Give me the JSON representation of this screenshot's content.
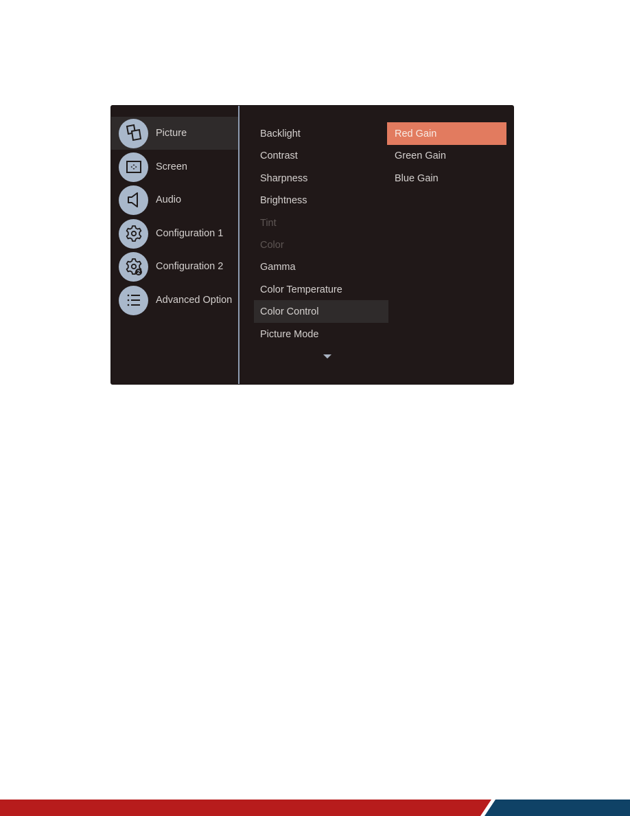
{
  "sidebar": {
    "items": [
      {
        "label": "Picture",
        "icon": "photos-icon",
        "active": true
      },
      {
        "label": "Screen",
        "icon": "screen-icon",
        "active": false
      },
      {
        "label": "Audio",
        "icon": "speaker-icon",
        "active": false
      },
      {
        "label": "Configuration 1",
        "icon": "gear-icon",
        "active": false
      },
      {
        "label": "Configuration 2",
        "icon": "gear-2-icon",
        "active": false
      },
      {
        "label": "Advanced Option",
        "icon": "list-icon",
        "active": false
      }
    ]
  },
  "picture_menu": {
    "items": [
      {
        "label": "Backlight",
        "state": "normal"
      },
      {
        "label": "Contrast",
        "state": "normal"
      },
      {
        "label": "Sharpness",
        "state": "normal"
      },
      {
        "label": "Brightness",
        "state": "normal"
      },
      {
        "label": "Tint",
        "state": "disabled"
      },
      {
        "label": "Color",
        "state": "disabled"
      },
      {
        "label": "Gamma",
        "state": "normal"
      },
      {
        "label": "Color Temperature",
        "state": "normal"
      },
      {
        "label": "Color Control",
        "state": "selected"
      },
      {
        "label": "Picture Mode",
        "state": "normal"
      }
    ],
    "more_indicator": "down-arrow-icon"
  },
  "color_control_menu": {
    "items": [
      {
        "label": "Red Gain",
        "state": "highlighted"
      },
      {
        "label": "Green Gain",
        "state": "normal"
      },
      {
        "label": "Blue Gain",
        "state": "normal"
      }
    ]
  },
  "colors": {
    "panel_bg": "#201818",
    "selected_bg": "#2f2b2b",
    "highlight": "#e27b5f",
    "icon_circle": "#a9b8cb",
    "divider": "#8e9bb0",
    "footer_red": "#b71c1c",
    "footer_blue": "#0f4266"
  }
}
